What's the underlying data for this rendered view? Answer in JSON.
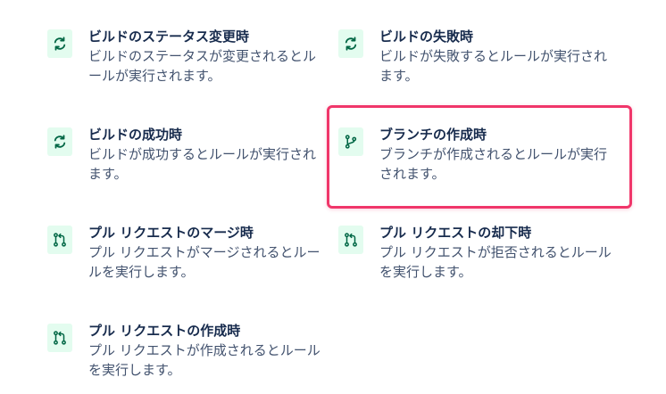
{
  "triggers": [
    {
      "title": "ビルドのステータス変更時",
      "description": "ビルドのステータスが変更されるとルールが実行されます。",
      "icon": "refresh-icon"
    },
    {
      "title": "ビルドの失敗時",
      "description": "ビルドが失敗するとルールが実行されます。",
      "icon": "refresh-icon"
    },
    {
      "title": "ビルドの成功時",
      "description": "ビルドが成功するとルールが実行されます。",
      "icon": "refresh-icon"
    },
    {
      "title": "ブランチの作成時",
      "description": "ブランチが作成されるとルールが実行されます。",
      "icon": "branch-icon"
    },
    {
      "title": "プル リクエストのマージ時",
      "description": "プル リクエストがマージされるとルールを実行します。",
      "icon": "pull-request-icon"
    },
    {
      "title": "プル リクエストの却下時",
      "description": "プル リクエストが拒否されるとルールを実行します。",
      "icon": "pull-request-icon"
    },
    {
      "title": "プル リクエストの作成時",
      "description": "プル リクエストが作成されるとルールを実行します。",
      "icon": "pull-request-icon"
    }
  ],
  "colors": {
    "icon_bg": "#E3FCEF",
    "icon_fg": "#006644",
    "highlight": "#F0366A",
    "title": "#172B4D",
    "desc": "#42526E"
  }
}
